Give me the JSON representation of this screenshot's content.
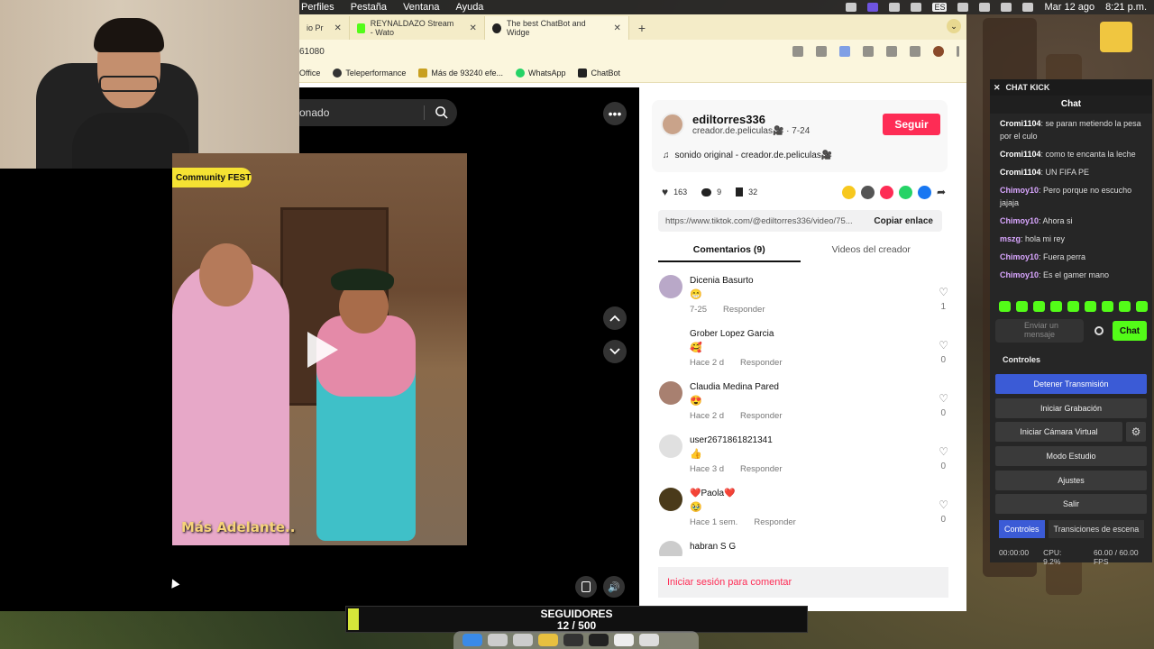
{
  "menubar": {
    "items": [
      "Perfiles",
      "Pestaña",
      "Ventana",
      "Ayuda"
    ],
    "date": "Mar 12 ago",
    "time": "8:21 p.m.",
    "lang": "ES"
  },
  "browser": {
    "tabs": [
      {
        "title": "io Pr",
        "fav_color": "#555"
      },
      {
        "title": "REYNALDAZO Stream - Wato",
        "fav_color": "#53fc18"
      },
      {
        "title": "The best ChatBot and Widge",
        "fav_color": "#222"
      }
    ],
    "new_tab": "+",
    "url": "61080",
    "bookmarks": [
      "Office",
      "Teleperformance",
      "Más de 93240 efe...",
      "WhatsApp",
      "ChatBot"
    ]
  },
  "player": {
    "search_placeholder": "onado",
    "more": "•••",
    "badge": "Community FEST",
    "caption": "Más Adelante.."
  },
  "panel": {
    "creator_name": "ediltorres336",
    "creator_sub": "creador.de.peliculas🎥 · 7-24",
    "follow": "Seguir",
    "sound": "sonido original - creador.de.peliculas🎥",
    "likes": "163",
    "comments_count": "9",
    "saves": "32",
    "link": "https://www.tiktok.com/@ediltorres336/video/75...",
    "copy_link": "Copiar enlace",
    "tab_comments": "Comentarios (9)",
    "tab_videos": "Videos del creador",
    "login": "Iniciar sesión para comentar",
    "comments": [
      {
        "name": "Dicenia Basurto",
        "text": "😁",
        "date": "7-25",
        "reply": "Responder",
        "likes": "1"
      },
      {
        "name": "Grober Lopez Garcia",
        "text": "🥰",
        "date": "Hace 2 d",
        "reply": "Responder",
        "likes": "0"
      },
      {
        "name": "Claudia Medina Pared",
        "text": "😍",
        "date": "Hace 2 d",
        "reply": "Responder",
        "likes": "0"
      },
      {
        "name": "user2671861821341",
        "text": "👍",
        "date": "Hace 3 d",
        "reply": "Responder",
        "likes": "0"
      },
      {
        "name": "❤️Paola❤️",
        "text": "🥹",
        "date": "Hace 1 sem.",
        "reply": "Responder",
        "likes": "0"
      },
      {
        "name": "habran S G",
        "text": "",
        "date": "",
        "reply": "",
        "likes": ""
      }
    ]
  },
  "obs": {
    "chat_dock": "CHAT KICK",
    "chat_title": "Chat",
    "messages": [
      {
        "user": "Cromi1104",
        "text": "se paran metiendo la pesa por el culo",
        "color": "#ffffff"
      },
      {
        "user": "Cromi1104",
        "text": "como te encanta la leche",
        "color": "#ffffff"
      },
      {
        "user": "Cromi1104",
        "text": "UN FIFA PE",
        "color": "#ffffff"
      },
      {
        "user": "Chimoy10",
        "text": "Pero porque no escucho jajaja",
        "color": "#d9a6ff"
      },
      {
        "user": "Chimoy10",
        "text": "Ahora si",
        "color": "#d9a6ff"
      },
      {
        "user": "mszg",
        "text": "hola mi rey",
        "color": "#d9a6ff"
      },
      {
        "user": "Chimoy10",
        "text": "Fuera perra",
        "color": "#d9a6ff"
      },
      {
        "user": "Chimoy10",
        "text": "Es el gamer mano",
        "color": "#d9a6ff"
      }
    ],
    "input_placeholder": "Enviar un mensaje",
    "send": "Chat",
    "controls_title": "Controles",
    "buttons": [
      "Detener Transmisión",
      "Iniciar Grabación",
      "Iniciar Cámara Virtual",
      "Modo Estudio",
      "Ajustes",
      "Salir"
    ],
    "tabs": [
      "Controles",
      "Transiciones de escena"
    ],
    "timer": "00:00:00",
    "cpu": "CPU: 9.2%",
    "fps": "60.00 / 60.00 FPS"
  },
  "followers": {
    "title": "SEGUIDORES",
    "count": "12 / 500",
    "progress": 0.024
  },
  "colors": {
    "tiktok_red": "#fe2c55",
    "kick_green": "#53fc18",
    "obs_blue": "#3b5bd6"
  }
}
